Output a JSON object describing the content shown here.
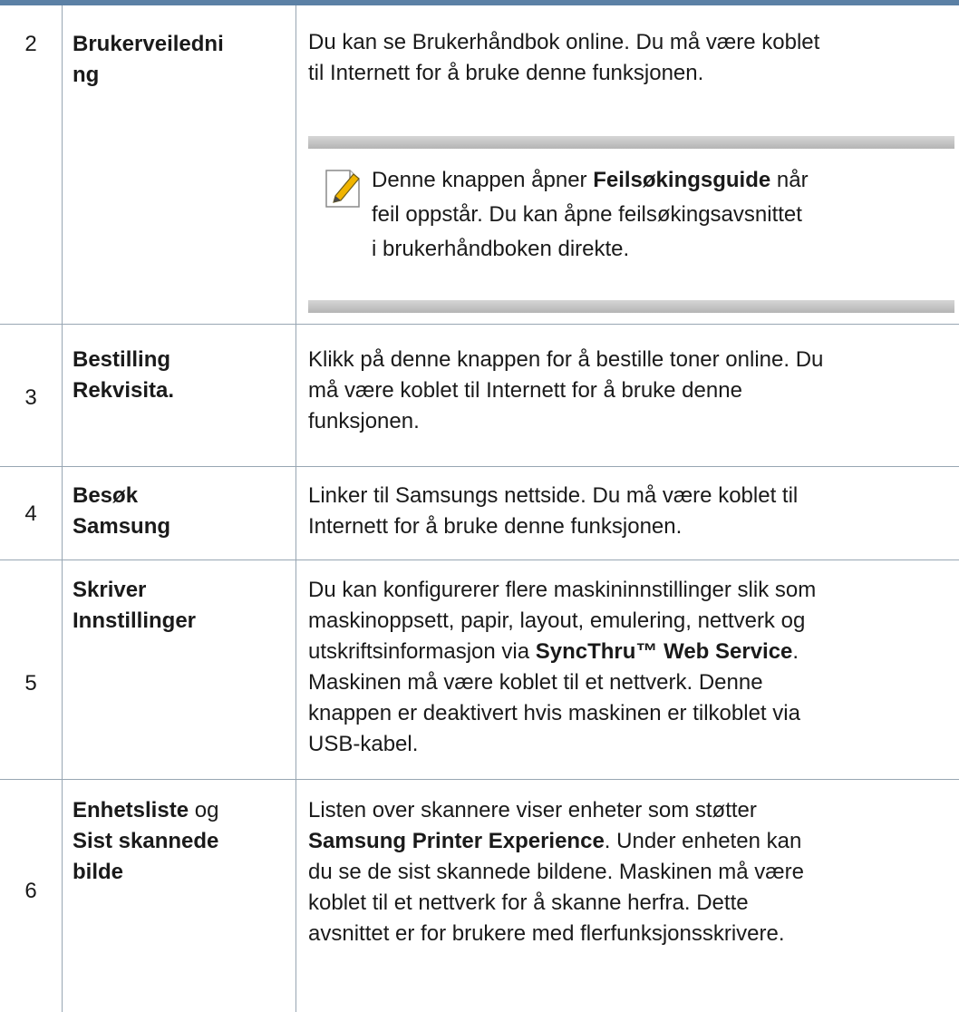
{
  "rows": [
    {
      "number": "2",
      "name_line1": "Brukerveiledni",
      "name_line2": "ng",
      "desc_line1": "Du kan se Brukerhåndbok online. Du må være koblet",
      "desc_line2": "til Internett for å bruke denne funksjonen.",
      "note": {
        "pre": "Denne knappen åpner ",
        "bold": "Feilsøkingsguide",
        "post_line1": " når",
        "line2": "feil oppstår. Du kan åpne feilsøkingsavsnittet",
        "line3": "i brukerhåndboken direkte."
      }
    },
    {
      "number": "3",
      "name_line1": "Bestilling",
      "name_line2": "Rekvisita.",
      "desc_line1": "Klikk på denne knappen for å bestille toner online. Du",
      "desc_line2": "må være koblet til Internett for å bruke denne",
      "desc_line3": "funksjonen."
    },
    {
      "number": "4",
      "name_line1": "Besøk",
      "name_line2": "Samsung",
      "desc_line1": "Linker til Samsungs nettside. Du må være koblet til",
      "desc_line2": "Internett for å bruke denne funksjonen."
    },
    {
      "number": "5",
      "name_line1": "Skriver",
      "name_line2": "Innstillinger",
      "desc_line1": "Du kan konfigurerer flere maskininnstillinger slik som",
      "desc_line2": "maskinoppsett, papir, layout, emulering, nettverk og",
      "desc_line3_pre": "utskriftsinformasjon via ",
      "desc_line3_bold": "SyncThru™ Web Service",
      "desc_line3_post": ".",
      "desc_line4": "Maskinen må være koblet til et nettverk. Denne",
      "desc_line5": "knappen er deaktivert hvis maskinen er tilkoblet via",
      "desc_line6": "USB-kabel."
    },
    {
      "number": "6",
      "name_line1_bold": "Enhetsliste",
      "name_line1_plain": " og",
      "name_line2": "Sist skannede",
      "name_line3": "bilde",
      "desc_line1": "Listen over skannere viser enheter som støtter",
      "desc_line2_bold": "Samsung Printer Experience",
      "desc_line2_post": ". Under enheten kan",
      "desc_line3": "du se de sist skannede bildene. Maskinen må være",
      "desc_line4": "koblet til et nettverk for å skanne herfra. Dette",
      "desc_line5": "avsnittet er for brukere med flerfunksjonsskrivere."
    }
  ],
  "colors": {
    "header_rule": "#5b80a5",
    "grid_line": "#98a6b3",
    "note_bar": "#c4c4c4",
    "note_icon_pencil": "#f0b400"
  },
  "icons": {
    "note": "note-pencil-icon"
  }
}
